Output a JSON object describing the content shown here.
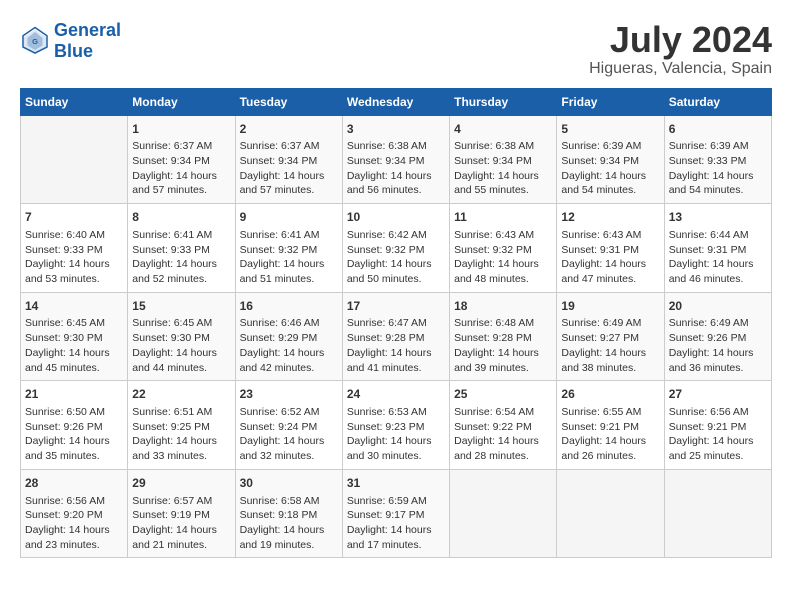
{
  "header": {
    "logo_line1": "General",
    "logo_line2": "Blue",
    "month": "July 2024",
    "location": "Higueras, Valencia, Spain"
  },
  "weekdays": [
    "Sunday",
    "Monday",
    "Tuesday",
    "Wednesday",
    "Thursday",
    "Friday",
    "Saturday"
  ],
  "weeks": [
    [
      {
        "day": "",
        "sunrise": "",
        "sunset": "",
        "daylight": ""
      },
      {
        "day": "1",
        "sunrise": "Sunrise: 6:37 AM",
        "sunset": "Sunset: 9:34 PM",
        "daylight": "Daylight: 14 hours and 57 minutes."
      },
      {
        "day": "2",
        "sunrise": "Sunrise: 6:37 AM",
        "sunset": "Sunset: 9:34 PM",
        "daylight": "Daylight: 14 hours and 57 minutes."
      },
      {
        "day": "3",
        "sunrise": "Sunrise: 6:38 AM",
        "sunset": "Sunset: 9:34 PM",
        "daylight": "Daylight: 14 hours and 56 minutes."
      },
      {
        "day": "4",
        "sunrise": "Sunrise: 6:38 AM",
        "sunset": "Sunset: 9:34 PM",
        "daylight": "Daylight: 14 hours and 55 minutes."
      },
      {
        "day": "5",
        "sunrise": "Sunrise: 6:39 AM",
        "sunset": "Sunset: 9:34 PM",
        "daylight": "Daylight: 14 hours and 54 minutes."
      },
      {
        "day": "6",
        "sunrise": "Sunrise: 6:39 AM",
        "sunset": "Sunset: 9:33 PM",
        "daylight": "Daylight: 14 hours and 54 minutes."
      }
    ],
    [
      {
        "day": "7",
        "sunrise": "Sunrise: 6:40 AM",
        "sunset": "Sunset: 9:33 PM",
        "daylight": "Daylight: 14 hours and 53 minutes."
      },
      {
        "day": "8",
        "sunrise": "Sunrise: 6:41 AM",
        "sunset": "Sunset: 9:33 PM",
        "daylight": "Daylight: 14 hours and 52 minutes."
      },
      {
        "day": "9",
        "sunrise": "Sunrise: 6:41 AM",
        "sunset": "Sunset: 9:32 PM",
        "daylight": "Daylight: 14 hours and 51 minutes."
      },
      {
        "day": "10",
        "sunrise": "Sunrise: 6:42 AM",
        "sunset": "Sunset: 9:32 PM",
        "daylight": "Daylight: 14 hours and 50 minutes."
      },
      {
        "day": "11",
        "sunrise": "Sunrise: 6:43 AM",
        "sunset": "Sunset: 9:32 PM",
        "daylight": "Daylight: 14 hours and 48 minutes."
      },
      {
        "day": "12",
        "sunrise": "Sunrise: 6:43 AM",
        "sunset": "Sunset: 9:31 PM",
        "daylight": "Daylight: 14 hours and 47 minutes."
      },
      {
        "day": "13",
        "sunrise": "Sunrise: 6:44 AM",
        "sunset": "Sunset: 9:31 PM",
        "daylight": "Daylight: 14 hours and 46 minutes."
      }
    ],
    [
      {
        "day": "14",
        "sunrise": "Sunrise: 6:45 AM",
        "sunset": "Sunset: 9:30 PM",
        "daylight": "Daylight: 14 hours and 45 minutes."
      },
      {
        "day": "15",
        "sunrise": "Sunrise: 6:45 AM",
        "sunset": "Sunset: 9:30 PM",
        "daylight": "Daylight: 14 hours and 44 minutes."
      },
      {
        "day": "16",
        "sunrise": "Sunrise: 6:46 AM",
        "sunset": "Sunset: 9:29 PM",
        "daylight": "Daylight: 14 hours and 42 minutes."
      },
      {
        "day": "17",
        "sunrise": "Sunrise: 6:47 AM",
        "sunset": "Sunset: 9:28 PM",
        "daylight": "Daylight: 14 hours and 41 minutes."
      },
      {
        "day": "18",
        "sunrise": "Sunrise: 6:48 AM",
        "sunset": "Sunset: 9:28 PM",
        "daylight": "Daylight: 14 hours and 39 minutes."
      },
      {
        "day": "19",
        "sunrise": "Sunrise: 6:49 AM",
        "sunset": "Sunset: 9:27 PM",
        "daylight": "Daylight: 14 hours and 38 minutes."
      },
      {
        "day": "20",
        "sunrise": "Sunrise: 6:49 AM",
        "sunset": "Sunset: 9:26 PM",
        "daylight": "Daylight: 14 hours and 36 minutes."
      }
    ],
    [
      {
        "day": "21",
        "sunrise": "Sunrise: 6:50 AM",
        "sunset": "Sunset: 9:26 PM",
        "daylight": "Daylight: 14 hours and 35 minutes."
      },
      {
        "day": "22",
        "sunrise": "Sunrise: 6:51 AM",
        "sunset": "Sunset: 9:25 PM",
        "daylight": "Daylight: 14 hours and 33 minutes."
      },
      {
        "day": "23",
        "sunrise": "Sunrise: 6:52 AM",
        "sunset": "Sunset: 9:24 PM",
        "daylight": "Daylight: 14 hours and 32 minutes."
      },
      {
        "day": "24",
        "sunrise": "Sunrise: 6:53 AM",
        "sunset": "Sunset: 9:23 PM",
        "daylight": "Daylight: 14 hours and 30 minutes."
      },
      {
        "day": "25",
        "sunrise": "Sunrise: 6:54 AM",
        "sunset": "Sunset: 9:22 PM",
        "daylight": "Daylight: 14 hours and 28 minutes."
      },
      {
        "day": "26",
        "sunrise": "Sunrise: 6:55 AM",
        "sunset": "Sunset: 9:21 PM",
        "daylight": "Daylight: 14 hours and 26 minutes."
      },
      {
        "day": "27",
        "sunrise": "Sunrise: 6:56 AM",
        "sunset": "Sunset: 9:21 PM",
        "daylight": "Daylight: 14 hours and 25 minutes."
      }
    ],
    [
      {
        "day": "28",
        "sunrise": "Sunrise: 6:56 AM",
        "sunset": "Sunset: 9:20 PM",
        "daylight": "Daylight: 14 hours and 23 minutes."
      },
      {
        "day": "29",
        "sunrise": "Sunrise: 6:57 AM",
        "sunset": "Sunset: 9:19 PM",
        "daylight": "Daylight: 14 hours and 21 minutes."
      },
      {
        "day": "30",
        "sunrise": "Sunrise: 6:58 AM",
        "sunset": "Sunset: 9:18 PM",
        "daylight": "Daylight: 14 hours and 19 minutes."
      },
      {
        "day": "31",
        "sunrise": "Sunrise: 6:59 AM",
        "sunset": "Sunset: 9:17 PM",
        "daylight": "Daylight: 14 hours and 17 minutes."
      },
      {
        "day": "",
        "sunrise": "",
        "sunset": "",
        "daylight": ""
      },
      {
        "day": "",
        "sunrise": "",
        "sunset": "",
        "daylight": ""
      },
      {
        "day": "",
        "sunrise": "",
        "sunset": "",
        "daylight": ""
      }
    ]
  ]
}
